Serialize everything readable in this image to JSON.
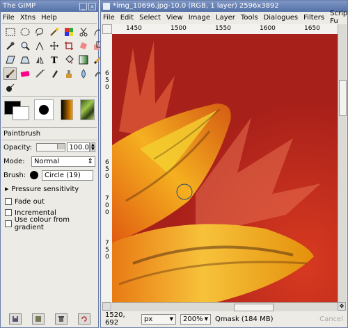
{
  "toolbox": {
    "title": "The GIMP",
    "menu": [
      "File",
      "Xtns",
      "Help"
    ]
  },
  "tool_options": {
    "title": "Paintbrush",
    "opacity_label": "Opacity:",
    "opacity_value": "100.0",
    "mode_label": "Mode:",
    "mode_value": "Normal",
    "brush_label": "Brush:",
    "brush_value": "Circle (19)",
    "pressure_label": "Pressure sensitivity",
    "fade_label": "Fade out",
    "incremental_label": "Incremental",
    "gradient_label": "Use colour from gradient"
  },
  "image_window": {
    "title": "*img_10696.jpg-10.0 (RGB, 1 layer) 2596x3892",
    "menu": [
      "File",
      "Edit",
      "Select",
      "View",
      "Image",
      "Layer",
      "Tools",
      "Dialogues",
      "Filters",
      "Script-Fu"
    ],
    "ruler_h": [
      "1450",
      "1500",
      "1550",
      "1600",
      "1650"
    ],
    "ruler_v": [
      "6",
      "5",
      "0",
      "6",
      "5",
      "0",
      "7",
      "0",
      "0",
      "7",
      "5",
      "0"
    ],
    "coords": "1520, 692",
    "unit": "px",
    "zoom": "200%",
    "status": "Qmask (184 MB)",
    "cancel": "Cancel"
  },
  "colors": {
    "titlebar": "#5c77ad",
    "canvas_bg": "#b42318"
  }
}
